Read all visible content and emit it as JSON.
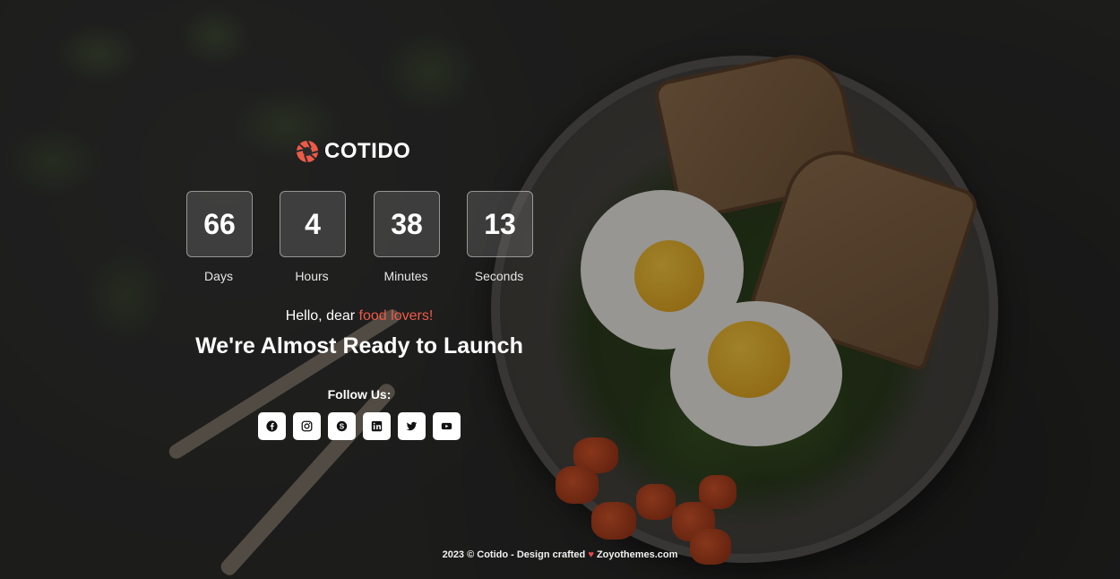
{
  "brand": {
    "name": "COTIDO",
    "accent": "#ee5a48"
  },
  "countdown": [
    {
      "value": "66",
      "label": "Days"
    },
    {
      "value": "4",
      "label": "Hours"
    },
    {
      "value": "38",
      "label": "Minutes"
    },
    {
      "value": "13",
      "label": "Seconds"
    }
  ],
  "greeting": {
    "prefix": "Hello, dear ",
    "highlight": "food lovers!"
  },
  "headline": "We're Almost Ready to Launch",
  "follow_label": "Follow Us:",
  "social": [
    "facebook-icon",
    "instagram-icon",
    "skype-icon",
    "linkedin-icon",
    "twitter-icon",
    "youtube-icon"
  ],
  "footer": {
    "left": "2023 © Cotido - Design crafted",
    "heart": "♥",
    "right": "Zoyothemes.com"
  }
}
